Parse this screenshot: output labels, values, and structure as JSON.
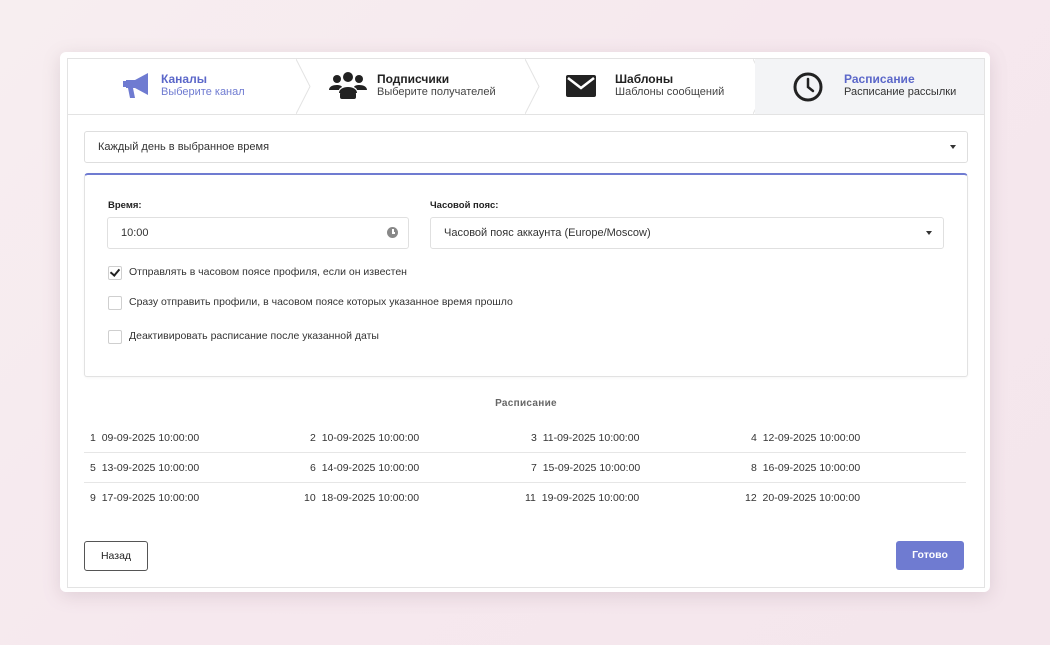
{
  "steps": [
    {
      "title": "Каналы",
      "subtitle": "Выберите канал",
      "icon": "megaphone-icon"
    },
    {
      "title": "Подписчики",
      "subtitle": "Выберите получателей",
      "icon": "users-icon"
    },
    {
      "title": "Шаблоны",
      "subtitle": "Шаблоны сообщений",
      "icon": "envelope-icon"
    },
    {
      "title": "Расписание",
      "subtitle": "Расписание рассылки",
      "icon": "clock-icon"
    }
  ],
  "frequency_select": {
    "value": "Каждый день в выбранное время"
  },
  "time": {
    "label": "Время:",
    "value": "10:00"
  },
  "timezone": {
    "label": "Часовой пояс:",
    "value": "Часовой пояс аккаунта (Europe/Moscow)"
  },
  "options": [
    {
      "label": "Отправлять в часовом поясе профиля, если он известен",
      "checked": true
    },
    {
      "label": "Сразу отправить профили, в часовом поясе которых указанное время прошло",
      "checked": false
    },
    {
      "label": "Деактивировать расписание после указанной даты",
      "checked": false
    }
  ],
  "schedule": {
    "title": "Расписание",
    "rows": [
      [
        {
          "n": "1",
          "d": "09-09-2025 10:00:00"
        },
        {
          "n": "2",
          "d": "10-09-2025 10:00:00"
        },
        {
          "n": "3",
          "d": "11-09-2025 10:00:00"
        },
        {
          "n": "4",
          "d": "12-09-2025 10:00:00"
        }
      ],
      [
        {
          "n": "5",
          "d": "13-09-2025 10:00:00"
        },
        {
          "n": "6",
          "d": "14-09-2025 10:00:00"
        },
        {
          "n": "7",
          "d": "15-09-2025 10:00:00"
        },
        {
          "n": "8",
          "d": "16-09-2025 10:00:00"
        }
      ],
      [
        {
          "n": "9",
          "d": "17-09-2025 10:00:00"
        },
        {
          "n": "10",
          "d": "18-09-2025 10:00:00"
        },
        {
          "n": "11",
          "d": "19-09-2025 10:00:00"
        },
        {
          "n": "12",
          "d": "20-09-2025 10:00:00"
        }
      ]
    ]
  },
  "buttons": {
    "back": "Назад",
    "done": "Готово"
  },
  "colors": {
    "accent": "#6f7bd1",
    "background": "#f7eef0"
  }
}
